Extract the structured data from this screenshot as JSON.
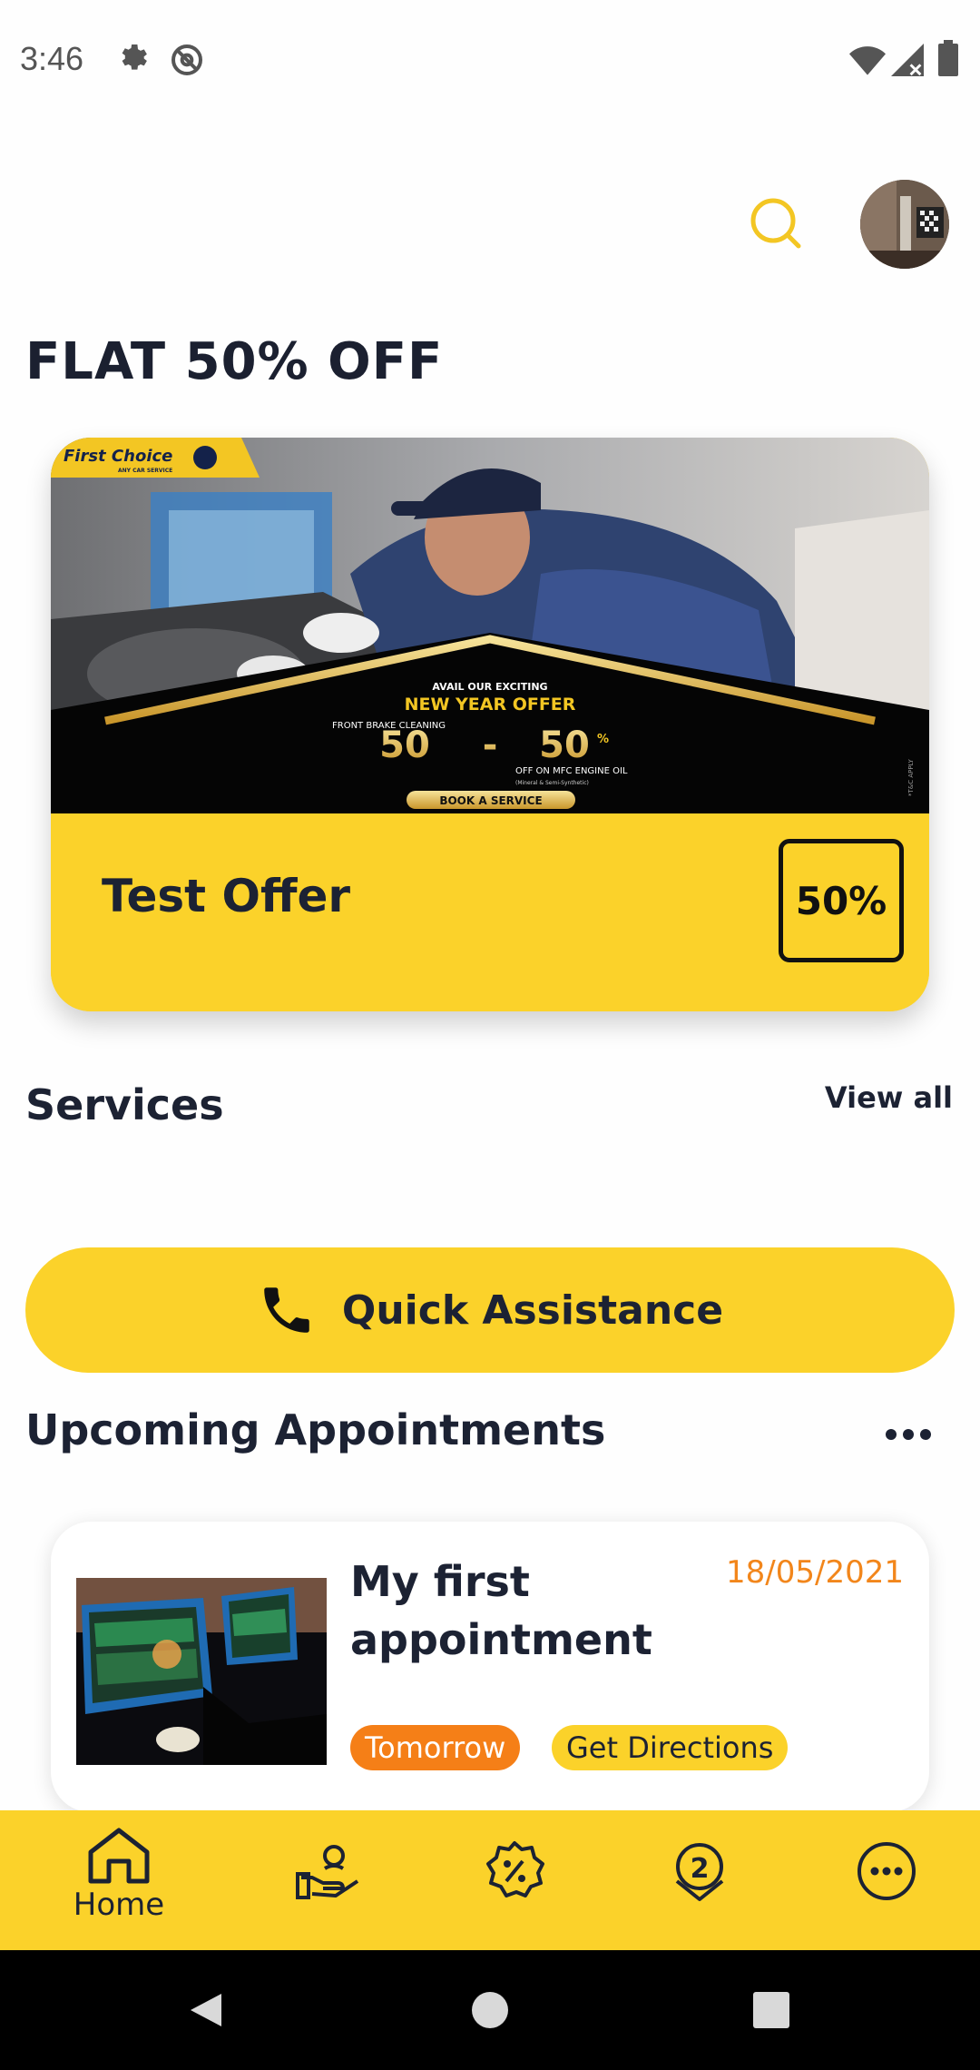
{
  "status_bar": {
    "time": "3:46",
    "icons": [
      "settings-icon",
      "at-sign-icon",
      "wifi-icon",
      "signal-icon",
      "battery-icon"
    ]
  },
  "header": {
    "search_icon": "search-icon",
    "avatar": "profile-avatar"
  },
  "promo": {
    "title": "FLAT 50% OFF",
    "offer": {
      "name": "Test Offer",
      "discount": "50%",
      "banner": {
        "brand": "First Choice",
        "brand_tag": "ANY CAR SERVICE",
        "line1": "AVAIL OUR EXCITING",
        "line2": "NEW YEAR OFFER",
        "left_label": "FRONT BRAKE CLEANING",
        "left_value": "50",
        "right_value": "50",
        "right_label": "OFF ON MFC ENGINE OIL",
        "right_sub": "(Mineral & Semi-Synthetic)",
        "cta": "BOOK A SERVICE",
        "tc": "*T&C APPLY"
      }
    }
  },
  "services": {
    "title": "Services",
    "view_all": "View all"
  },
  "quick_assistance": {
    "label": "Quick Assistance"
  },
  "appointments": {
    "title": "Upcoming Appointments",
    "items": [
      {
        "name": "My first appointment",
        "date": "18/05/2021",
        "chip_when": "Tomorrow",
        "chip_action": "Get Directions"
      }
    ]
  },
  "bottom_nav": {
    "items": [
      {
        "label": "Home",
        "icon": "home-icon"
      },
      {
        "label": "",
        "icon": "service-hand-icon"
      },
      {
        "label": "",
        "icon": "discount-badge-icon"
      },
      {
        "label": "",
        "icon": "location-pin-icon"
      },
      {
        "label": "",
        "icon": "more-circle-icon"
      }
    ]
  },
  "colors": {
    "accent_yellow": "#fbd22a",
    "accent_orange": "#f57f17",
    "date_orange": "#f2861b",
    "text_dark": "#1c2233"
  }
}
